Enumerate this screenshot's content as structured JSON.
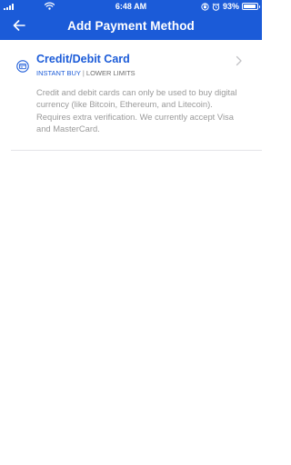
{
  "status_bar": {
    "time": "6:48 AM",
    "battery_percent": "93%",
    "battery_level": 0.93,
    "signal_icon": "cellular-signal-icon",
    "wifi_icon": "wifi-icon",
    "orientation_lock_icon": "orientation-lock-icon",
    "alarm_icon": "alarm-clock-icon"
  },
  "header": {
    "title": "Add Payment Method",
    "back_icon": "arrow-left-icon",
    "background_color": "#1b5bd8"
  },
  "payment_options": [
    {
      "title": "Credit/Debit Card",
      "tag_primary": "INSTANT BUY",
      "tag_separator": "|",
      "tag_secondary": "LOWER LIMITS",
      "description": "Credit and debit cards can only be used to buy digital currency (like Bitcoin, Ethereum, and Litecoin). Requires extra verification. We currently accept Visa and MasterCard.",
      "icon": "credit-card-icon",
      "action_icon": "chevron-right-icon"
    }
  ],
  "colors": {
    "accent": "#1b5bd8",
    "description_text": "#9a9a9a",
    "divider": "#e4e4e8"
  }
}
